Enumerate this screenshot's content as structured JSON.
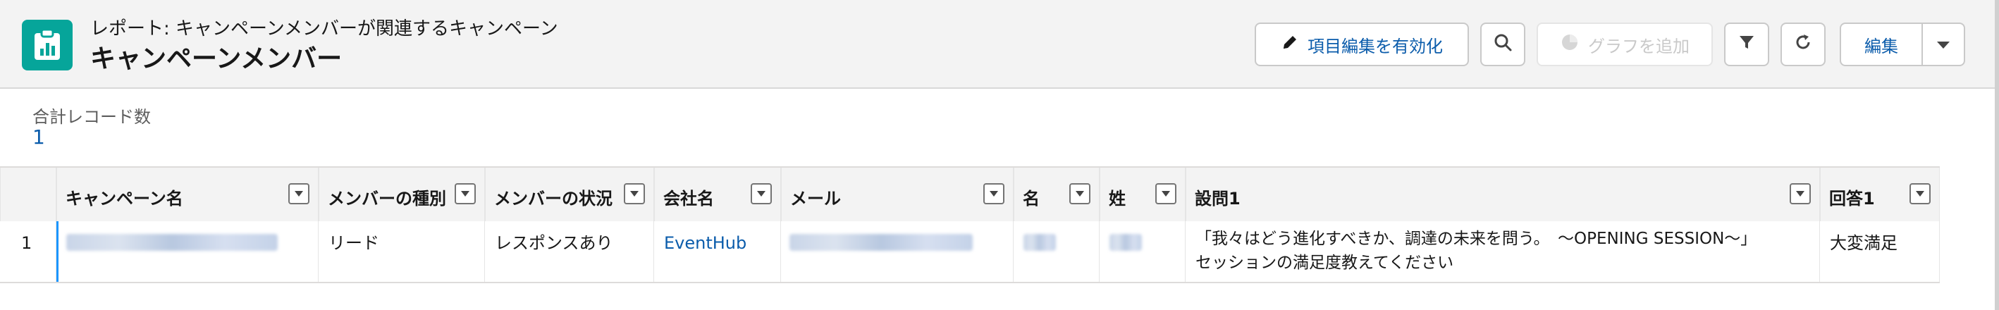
{
  "header": {
    "subtitle": "レポート: キャンペーンメンバーが関連するキャンペーン",
    "title": "キャンペーンメンバー",
    "app_icon": "report-icon",
    "buttons": {
      "enable_field_edit": "項目編集を有効化",
      "add_chart": "グラフを追加",
      "edit": "編集"
    },
    "icons": [
      "pencil-icon",
      "search-icon",
      "chart-icon",
      "filter-icon",
      "refresh-icon",
      "chevron-down-icon"
    ]
  },
  "summary": {
    "label": "合計レコード数",
    "value": "1"
  },
  "table": {
    "columns": [
      {
        "label": ""
      },
      {
        "label": "キャンペーン名"
      },
      {
        "label": "メンバーの種別"
      },
      {
        "label": "メンバーの状況"
      },
      {
        "label": "会社名"
      },
      {
        "label": "メール"
      },
      {
        "label": "名"
      },
      {
        "label": "姓"
      },
      {
        "label": "設問1"
      },
      {
        "label": "回答1"
      }
    ],
    "rows": [
      {
        "num": "1",
        "member_type": "リード",
        "member_status": "レスポンスあり",
        "company": "EventHub",
        "question_line1": "「我々はどう進化すべきか、調達の未来を問う。　〜OPENING SESSION〜」",
        "question_line2": "セッションの満足度教えてください",
        "answer": "大変満足"
      }
    ]
  },
  "colors": {
    "accent": "#06a59a",
    "link": "#0b5cab",
    "header_bg": "#f3f3f3"
  }
}
